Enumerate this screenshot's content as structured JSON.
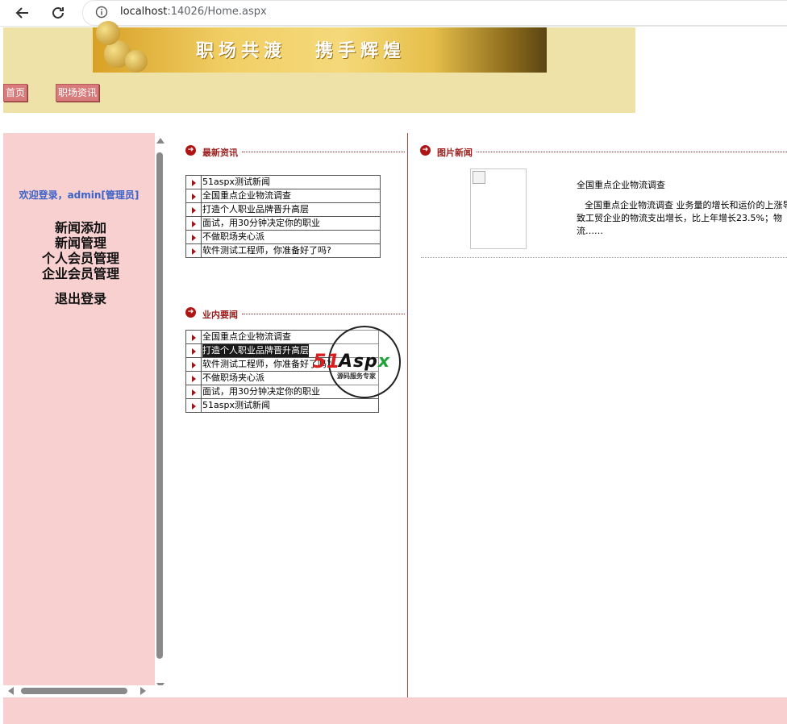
{
  "browser": {
    "url_host": "localhost",
    "url_path": ":14026/Home.aspx"
  },
  "banner": {
    "text_left": "职场共渡",
    "text_right": "携手辉煌"
  },
  "topnav": {
    "home": "首页",
    "career_news": "职场资讯"
  },
  "sidebar": {
    "welcome": "欢迎登录，admin[管理员]",
    "links": [
      "新闻添加",
      "新闻管理",
      "个人会员管理",
      "企业会员管理",
      "退出登录"
    ]
  },
  "latest": {
    "title": "最新资讯",
    "items": [
      "51aspx测试新闻",
      "全国重点企业物流调查",
      "打造个人职业品牌晋升高层",
      "面试，用30分钟决定你的职业",
      "不做职场夹心派",
      "软件测试工程师，你准备好了吗?"
    ]
  },
  "industry": {
    "title": "业内要闻",
    "items": [
      "全国重点企业物流调查",
      "打造个人职业品牌晋升高层",
      "软件测试工程师，你准备好了吗?",
      "不做职场夹心派",
      "面试，用30分钟决定你的职业",
      "51aspx测试新闻"
    ]
  },
  "picnews": {
    "title": "图片新闻",
    "headline": "全国重点企业物流调查",
    "desc": "全国重点企业物流调查 业务量的增长和运价的上涨导致工贸企业的物流支出增长，比上年增长23.5%；物流……"
  },
  "watermark": {
    "brand_51": "51",
    "brand_asp": "Asp",
    "brand_x": "x",
    "tagline": "源码服务专家"
  },
  "colors": {
    "banner_bg": "#efe2a8",
    "sidebar_bg": "#f8d0d0",
    "accent_red": "#b01515",
    "welcome_blue": "#3b63c9"
  }
}
